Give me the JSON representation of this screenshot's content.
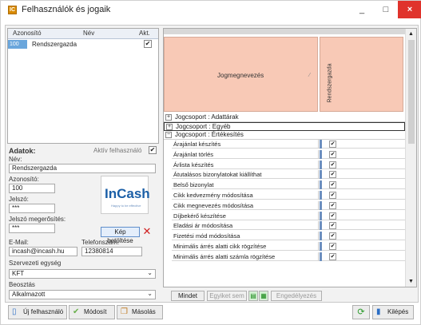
{
  "window": {
    "title": "Felhasználók és jogaik",
    "minimize": "_",
    "maximize": "□",
    "close": "×"
  },
  "user_list": {
    "headers": [
      "Azonosító",
      "Név",
      "Akt."
    ],
    "rows": [
      {
        "id": "100",
        "name": "Rendszergazda",
        "active": true
      }
    ]
  },
  "form": {
    "section_title": "Adatok:",
    "active_label": "Aktív felhasználó",
    "name_label": "Név:",
    "name_value": "Rendszergazda",
    "id_label": "Azonosító:",
    "id_value": "100",
    "password_label": "Jelszó:",
    "password_value": "***",
    "password_confirm_label": "Jelszó megerősítés:",
    "password_confirm_value": "***",
    "load_image_button": "Kép betöltése",
    "email_label": "E-Mail:",
    "email_value": "incash@incash.hu",
    "phone_label": "Telefonszám:",
    "phone_value": "12380814",
    "org_label": "Szervezeti egység",
    "org_value": "KFT",
    "role_label": "Beosztás",
    "role_value": "Alkalmazott",
    "logo_text": "InCash",
    "logo_sub": "Happy to be effective"
  },
  "grid": {
    "header_title": "Jogmegnevezés",
    "header_col": "Rendszergazda",
    "groups": [
      {
        "label": "Jogcsoport : Adattárak",
        "sign": "+"
      },
      {
        "label": "Jogcsoport : Egyéb",
        "sign": "+"
      },
      {
        "label": "Jogcsoport : Értékesítés",
        "sign": "−"
      }
    ],
    "rights": [
      "Árajánlat készítés",
      "Árajánlat törlés",
      "Árlista készítés",
      "Átutalásos bizonylatokat kiállíthat",
      "Belső bizonylat",
      "Cikk kedvezmény módosítása",
      "Cikk megnevezés módosítása",
      "Díjbekérő készítése",
      "Eladási ár módosítása",
      "Fizetési mód módosítása",
      "Minimális árrés alatti cikk rögzítése",
      "Minimális árrés alatti számla rögzítése"
    ],
    "check_mark": "✔"
  },
  "grid_buttons": {
    "all": "Mindet",
    "none": "Egyiket sem",
    "allow": "Engedélyezés"
  },
  "toolbar": {
    "new_user": "Új felhasználó",
    "modify": "Módosít",
    "copy": "Másolás",
    "exit": "Kilépés"
  }
}
